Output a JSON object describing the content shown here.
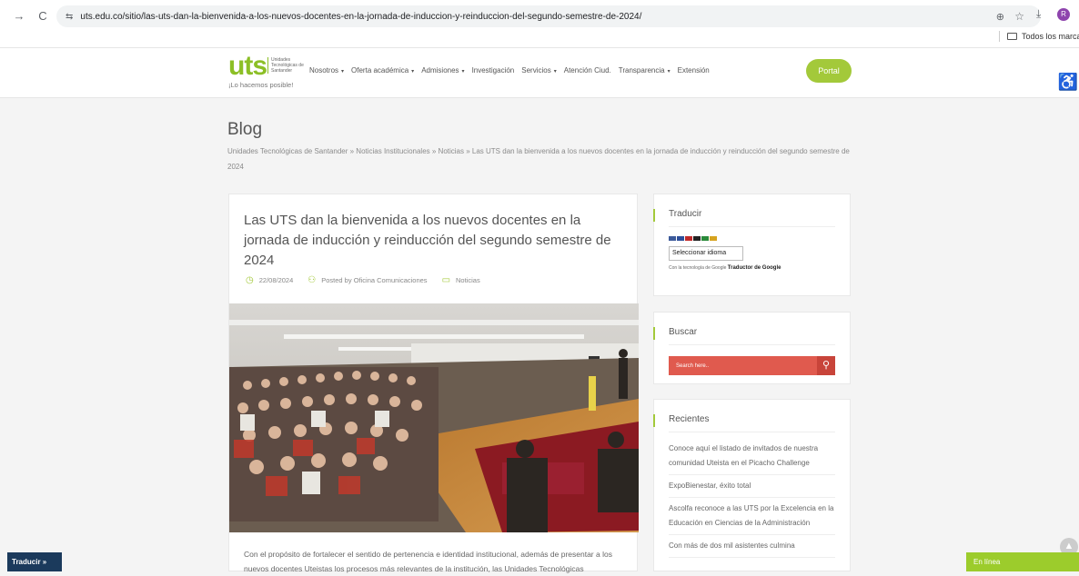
{
  "browser": {
    "url": "uts.edu.co/sitio/las-uts-dan-la-bienvenida-a-los-nuevos-docentes-en-la-jornada-de-induccion-y-reinduccion-del-segundo-semestre-de-2024/",
    "profile_initial": "R",
    "bookmarks_label": "Todos los marcad",
    "back_icon": "→",
    "reload_icon": "C",
    "tune_icon": "⇆",
    "zoom_icon": "⊕",
    "star_icon": "☆",
    "download_icon": "⤓"
  },
  "site": {
    "logo_text": "uts",
    "institution": "Unidades Tecnológicas de Santander",
    "slogan": "¡Lo hacemos posible!",
    "menu": [
      {
        "label": "Nosotros",
        "dropdown": true
      },
      {
        "label": "Oferta académica",
        "dropdown": true
      },
      {
        "label": "Admisiones",
        "dropdown": true
      },
      {
        "label": "Investigación",
        "dropdown": false
      },
      {
        "label": "Servicios",
        "dropdown": true
      },
      {
        "label": "Atención Ciud.",
        "dropdown": false
      },
      {
        "label": "Transparencia",
        "dropdown": true
      },
      {
        "label": "Extensión",
        "dropdown": false
      }
    ],
    "portal_label": "Portal",
    "accessibility_icon": "♿"
  },
  "page": {
    "title": "Blog",
    "breadcrumb": "Unidades Tecnológicas de Santander » Noticias Institucionales » Noticias » Las UTS dan la bienvenida a los nuevos docentes en la jornada de inducción y reinducción del segundo semestre de 2024"
  },
  "article": {
    "title": "Las UTS dan la bienvenida a los nuevos docentes en la jornada de inducción y reinducción del segundo semestre de 2024",
    "date": "22/08/2024",
    "author": "Posted by Oficina Comunicaciones",
    "category": "Noticias",
    "lead": "Con el propósito de fortalecer el sentido de pertenencia e identidad institucional, además de presentar a los nuevos docentes Uteistas los procesos más relevantes de la institución, las Unidades Tecnológicas"
  },
  "sidebar": {
    "translate": {
      "title": "Traducir",
      "select_value": "Seleccionar idioma",
      "powered_prefix": "Con la tecnología de",
      "powered_brand": "Google",
      "powered_suffix": "Traductor de Google"
    },
    "search": {
      "title": "Buscar",
      "placeholder": "Search here.."
    },
    "recent": {
      "title": "Recientes",
      "items": [
        "Conoce aquí el listado de invitados de nuestra comunidad Uteista en el Picacho Challenge",
        "ExpoBienestar, éxito total",
        "Ascolfa reconoce a las UTS por la Excelencia en la Educación en Ciencias de la Administración",
        "Con más de dos mil asistentes culmina"
      ]
    }
  },
  "floating": {
    "translate_bar": "Traducir »",
    "online_chat": "En línea"
  },
  "colors": {
    "brand_green": "#8cbf26",
    "search_red": "#e05a4e",
    "chat_green": "#9ccc2c",
    "translate_navy": "#1b3a5c"
  }
}
